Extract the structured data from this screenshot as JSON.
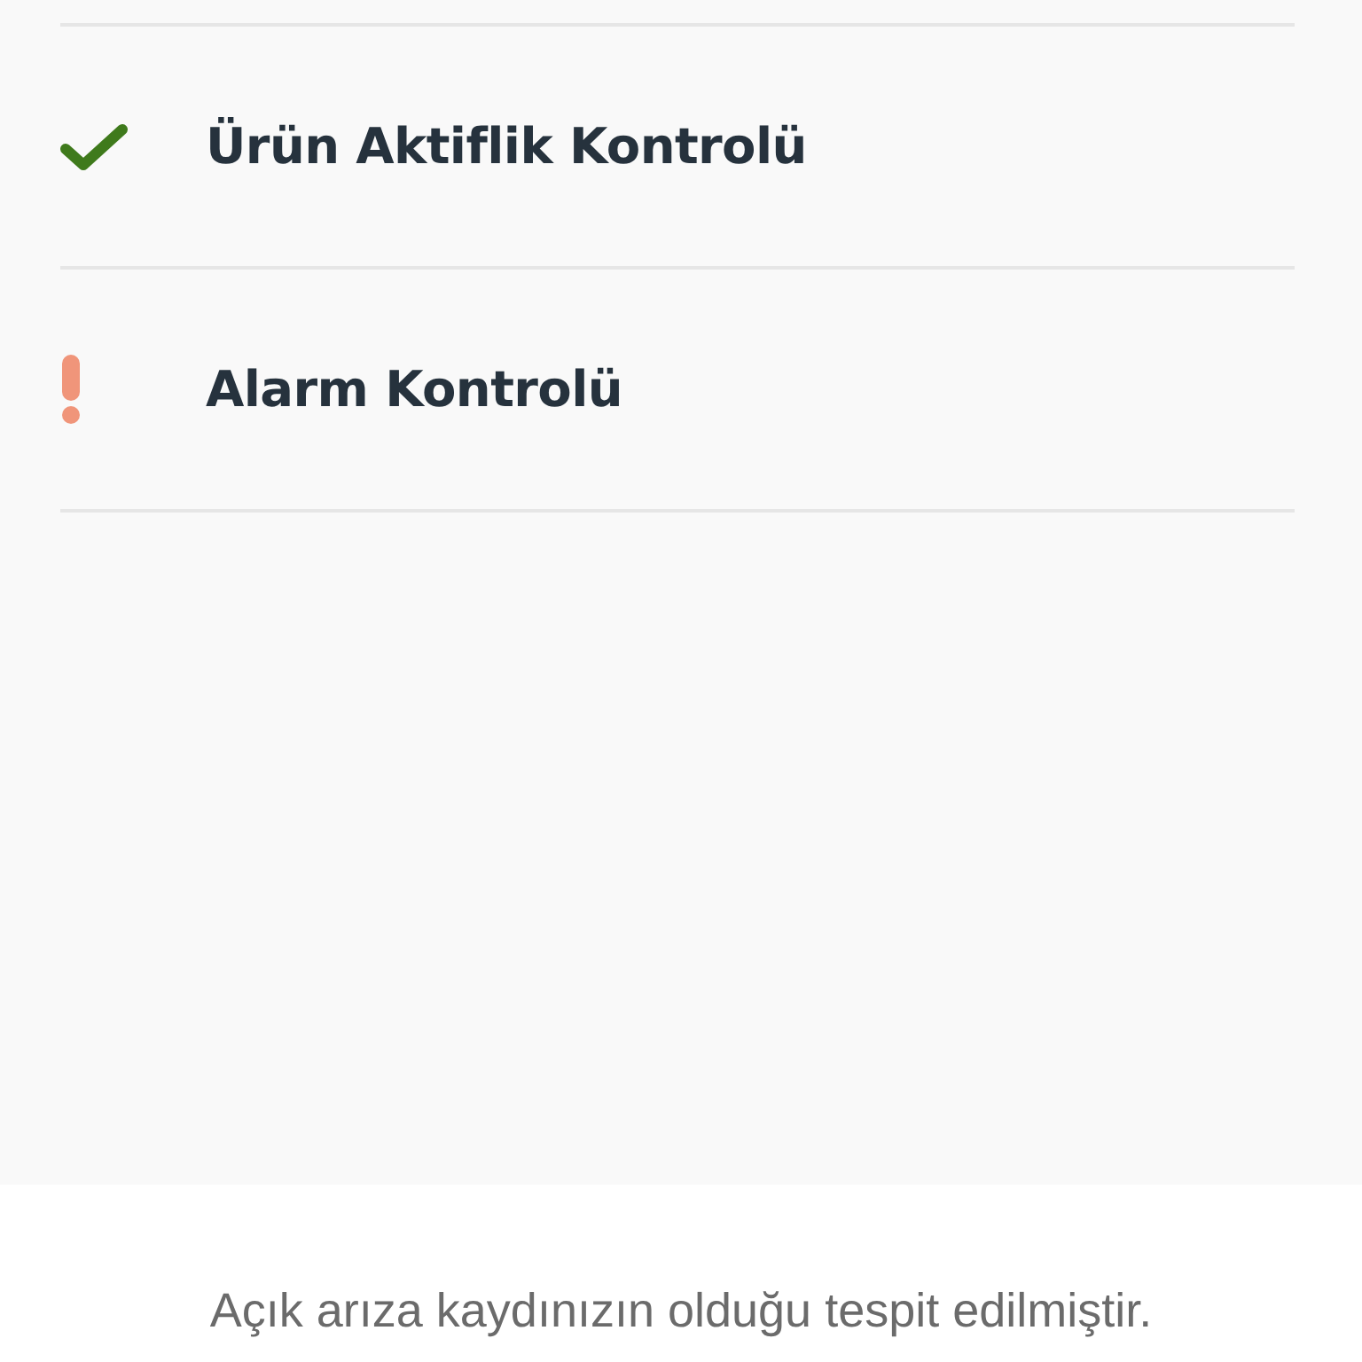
{
  "checks": [
    {
      "label": "Ürün Aktiflik Kontrolü",
      "kind": "passed"
    },
    {
      "label": "Alarm Kontrolü",
      "kind": "warning"
    }
  ],
  "message": "Açık arıza kaydınızın olduğu tespit edilmiştir."
}
